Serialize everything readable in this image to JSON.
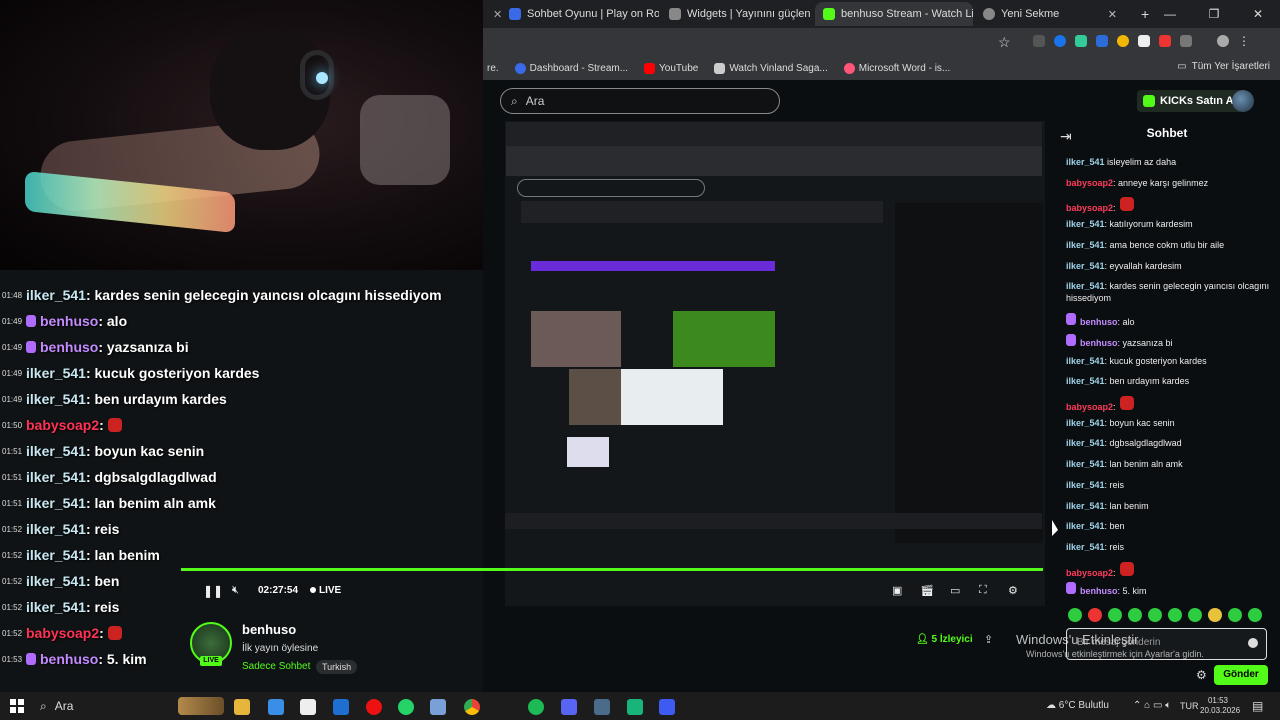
{
  "browser": {
    "tabs": [
      {
        "label": "Sohbet Oyunu | Play on Roblox",
        "color": "#3b6ae8"
      },
      {
        "label": "Widgets | Yayınını güçlendirme",
        "color": "#888888"
      },
      {
        "label": "benhuso Stream - Watch Live o",
        "color": "#53fc18"
      },
      {
        "label": "Yeni Sekme",
        "color": "#888888"
      }
    ],
    "bookmarks": [
      {
        "label": "Dashboard - Stream...",
        "color": "#3b6ae8"
      },
      {
        "label": "YouTube",
        "color": "#ff0000"
      },
      {
        "label": "Watch Vinland Saga...",
        "color": "#cccccc"
      },
      {
        "label": "Microsoft Word - is...",
        "color": "#ff5577"
      }
    ],
    "all_bookmarks": "Tüm Yer İşaretleri"
  },
  "page": {
    "search_placeholder": "Ara",
    "buy_kicks": "KICKs Satın Al"
  },
  "overlay_chat": [
    {
      "time": "01:48",
      "user": "ilker_541",
      "style": "",
      "msg": ": kardes senin gelecegin yaıncısı olcagını hissediyom"
    },
    {
      "time": "01:49",
      "user": "benhuso",
      "style": "pur",
      "msg": ": alo"
    },
    {
      "time": "01:49",
      "user": "benhuso",
      "style": "pur",
      "msg": ": yazsanıza bi"
    },
    {
      "time": "01:49",
      "user": "ilker_541",
      "style": "",
      "msg": ": kucuk gosteriyon kardes"
    },
    {
      "time": "01:49",
      "user": "ilker_541",
      "style": "",
      "msg": ": ben urdayım kardes"
    },
    {
      "time": "01:50",
      "user": "babysoap2",
      "style": "red",
      "msg": ":"
    },
    {
      "time": "01:51",
      "user": "ilker_541",
      "style": "",
      "msg": ": boyun kac senin"
    },
    {
      "time": "01:51",
      "user": "ilker_541",
      "style": "",
      "msg": ": dgbsalgdlagdlwad"
    },
    {
      "time": "01:51",
      "user": "ilker_541",
      "style": "",
      "msg": ": lan benim aln amk"
    },
    {
      "time": "01:52",
      "user": "ilker_541",
      "style": "",
      "msg": ": reis"
    },
    {
      "time": "01:52",
      "user": "ilker_541",
      "style": "",
      "msg": ": lan benim"
    },
    {
      "time": "01:52",
      "user": "ilker_541",
      "style": "",
      "msg": ": ben"
    },
    {
      "time": "01:52",
      "user": "ilker_541",
      "style": "",
      "msg": ": reis"
    },
    {
      "time": "01:52",
      "user": "babysoap2",
      "style": "red",
      "msg": ":"
    },
    {
      "time": "01:53",
      "user": "benhuso",
      "style": "pur",
      "msg": ": 5. kim"
    }
  ],
  "chat": {
    "title": "Sohbet",
    "messages": [
      {
        "user": "ilker_541",
        "style": "",
        "msg": " isleyelim az daha"
      },
      {
        "user": "babysoap2",
        "style": "red",
        "msg": ": anneye karşı gelinmez"
      },
      {
        "user": "babysoap2",
        "style": "red",
        "msg": ":"
      },
      {
        "user": "ilker_541",
        "style": "",
        "msg": ": katılıyorum kardesim"
      },
      {
        "user": "ilker_541",
        "style": "",
        "msg": ": ama bence cokm utlu bir aile"
      },
      {
        "user": "ilker_541",
        "style": "",
        "msg": ": eyvallah kardesim"
      },
      {
        "user": "ilker_541",
        "style": "",
        "msg": ": kardes senin gelecegin yaıncısı olcagını hissediyom"
      },
      {
        "user": "benhuso",
        "style": "pur",
        "msg": ": alo"
      },
      {
        "user": "benhuso",
        "style": "pur",
        "msg": ": yazsanıza bi"
      },
      {
        "user": "ilker_541",
        "style": "",
        "msg": ": kucuk gosteriyon kardes"
      },
      {
        "user": "ilker_541",
        "style": "",
        "msg": ": ben urdayım kardes"
      },
      {
        "user": "babysoap2",
        "style": "red",
        "msg": ":"
      },
      {
        "user": "ilker_541",
        "style": "",
        "msg": ": boyun kac senin"
      },
      {
        "user": "ilker_541",
        "style": "",
        "msg": ": dgbsalgdlagdlwad"
      },
      {
        "user": "ilker_541",
        "style": "",
        "msg": ": lan benim aln amk"
      },
      {
        "user": "ilker_541",
        "style": "",
        "msg": ": reis"
      },
      {
        "user": "ilker_541",
        "style": "",
        "msg": ": lan benim"
      },
      {
        "user": "ilker_541",
        "style": "",
        "msg": ": ben"
      },
      {
        "user": "ilker_541",
        "style": "",
        "msg": ": reis"
      },
      {
        "user": "babysoap2",
        "style": "red",
        "msg": ":"
      },
      {
        "user": "benhuso",
        "style": "pur",
        "msg": ": 5. kim"
      }
    ],
    "input_placeholder": "Bir mesaj gönderin",
    "send_label": "Gönder"
  },
  "stream": {
    "streamer": "benhuso",
    "title": "İlk yayın öylesine",
    "chat_mode": "Sadece Sohbet",
    "language": "Turkish",
    "live_badge": "LIVE",
    "viewers": "5 İzleyici",
    "timecode": "02:27:54",
    "live_label": "LIVE"
  },
  "windows_activation": {
    "title": "Windows'u Etkinleştir",
    "subtitle": "Windows'u etkinleştirmek için Ayarlar'a gidin."
  },
  "taskbar": {
    "search": "Ara",
    "weather": "6°C Bulutlu",
    "lang": "TUR",
    "time": "01:53",
    "date": "20.03.2026"
  }
}
